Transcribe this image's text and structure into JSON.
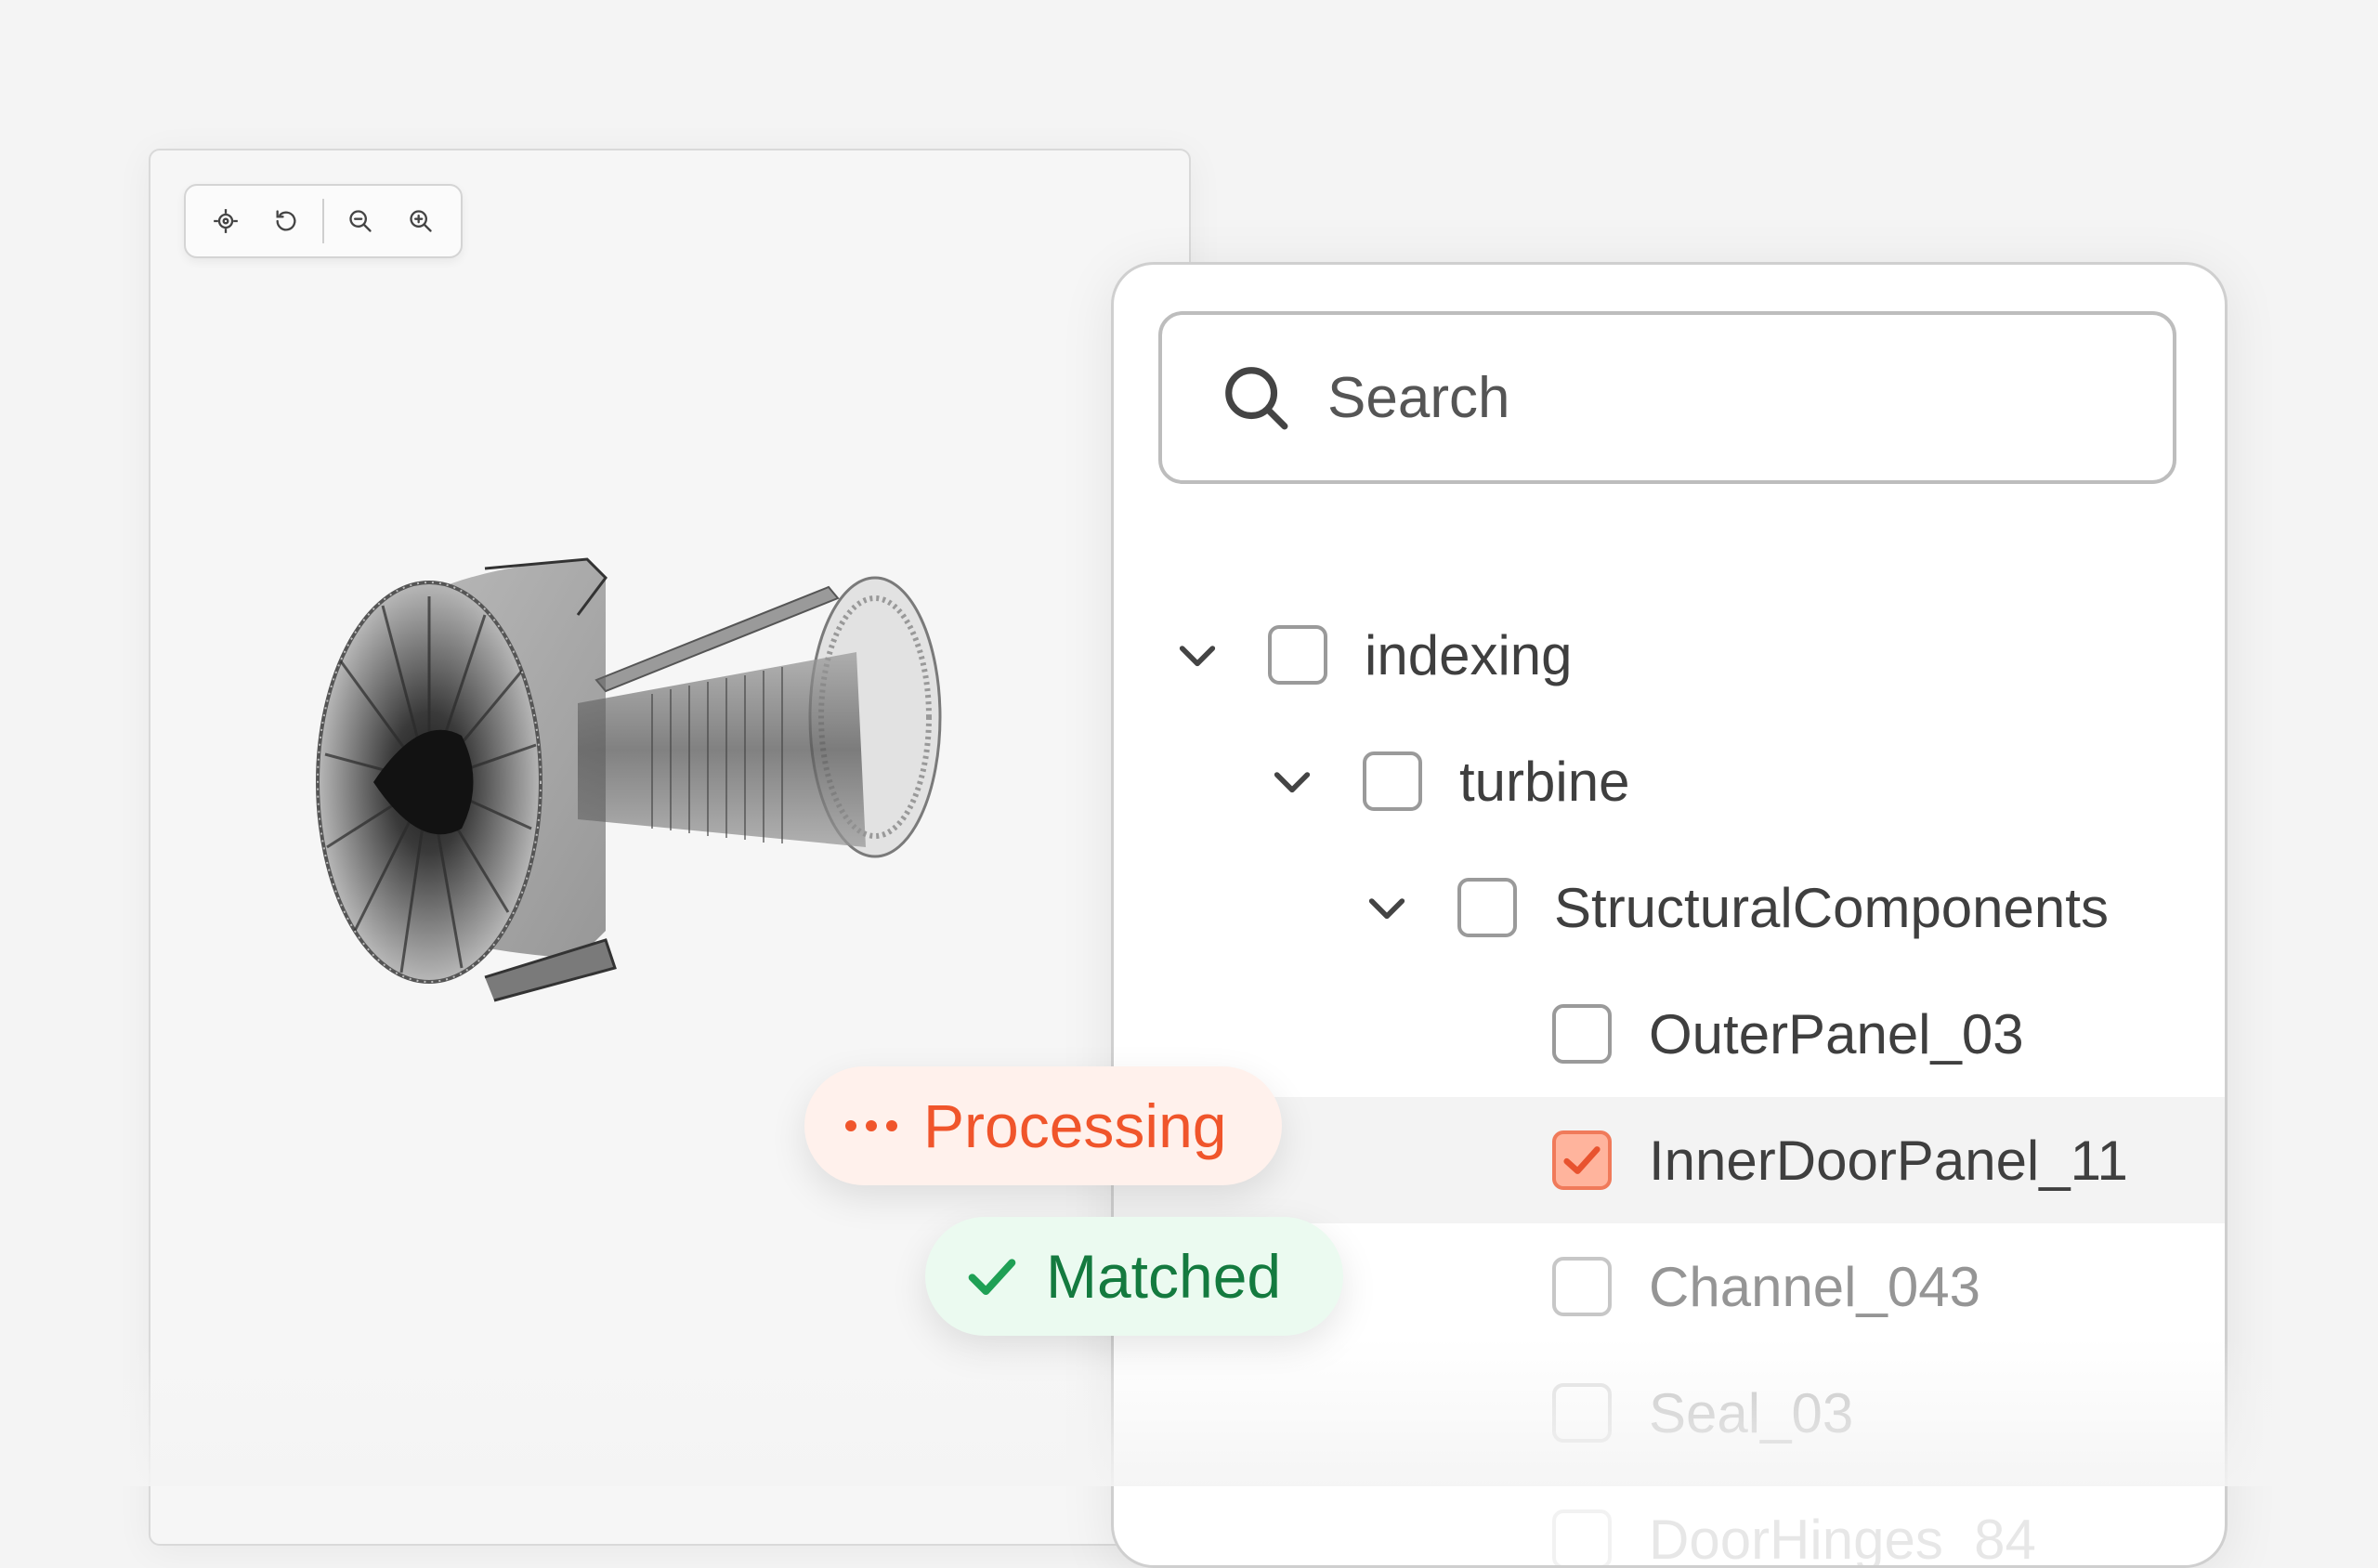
{
  "toolbar": {
    "buttons": [
      {
        "icon": "crosshair-icon"
      },
      {
        "icon": "rotate-reset-icon"
      },
      {
        "icon": "zoom-out-icon"
      },
      {
        "icon": "zoom-in-icon"
      }
    ]
  },
  "viewer": {
    "model_icon": "turbine-engine-model"
  },
  "search": {
    "placeholder": "Search",
    "value": ""
  },
  "tree": {
    "items": [
      {
        "label": "indexing",
        "expanded": true,
        "checked": false
      },
      {
        "label": "turbine",
        "expanded": true,
        "checked": false
      },
      {
        "label": "StructuralComponents",
        "expanded": true,
        "checked": false
      },
      {
        "label": "OuterPanel_03",
        "checked": false
      },
      {
        "label": "InnerDoorPanel_11",
        "checked": true,
        "selected": true
      },
      {
        "label": "Channel_043",
        "checked": false
      },
      {
        "label": "Seal_03",
        "checked": false
      },
      {
        "label": "DoorHinges_84",
        "checked": false
      }
    ]
  },
  "status": {
    "processing_label": "Processing",
    "matched_label": "Matched",
    "processing_color": "#f0552b",
    "matched_color": "#147a3f"
  },
  "colors": {
    "accent_checked": "#ffb49d",
    "accent_checked_border": "#f07a5a"
  }
}
